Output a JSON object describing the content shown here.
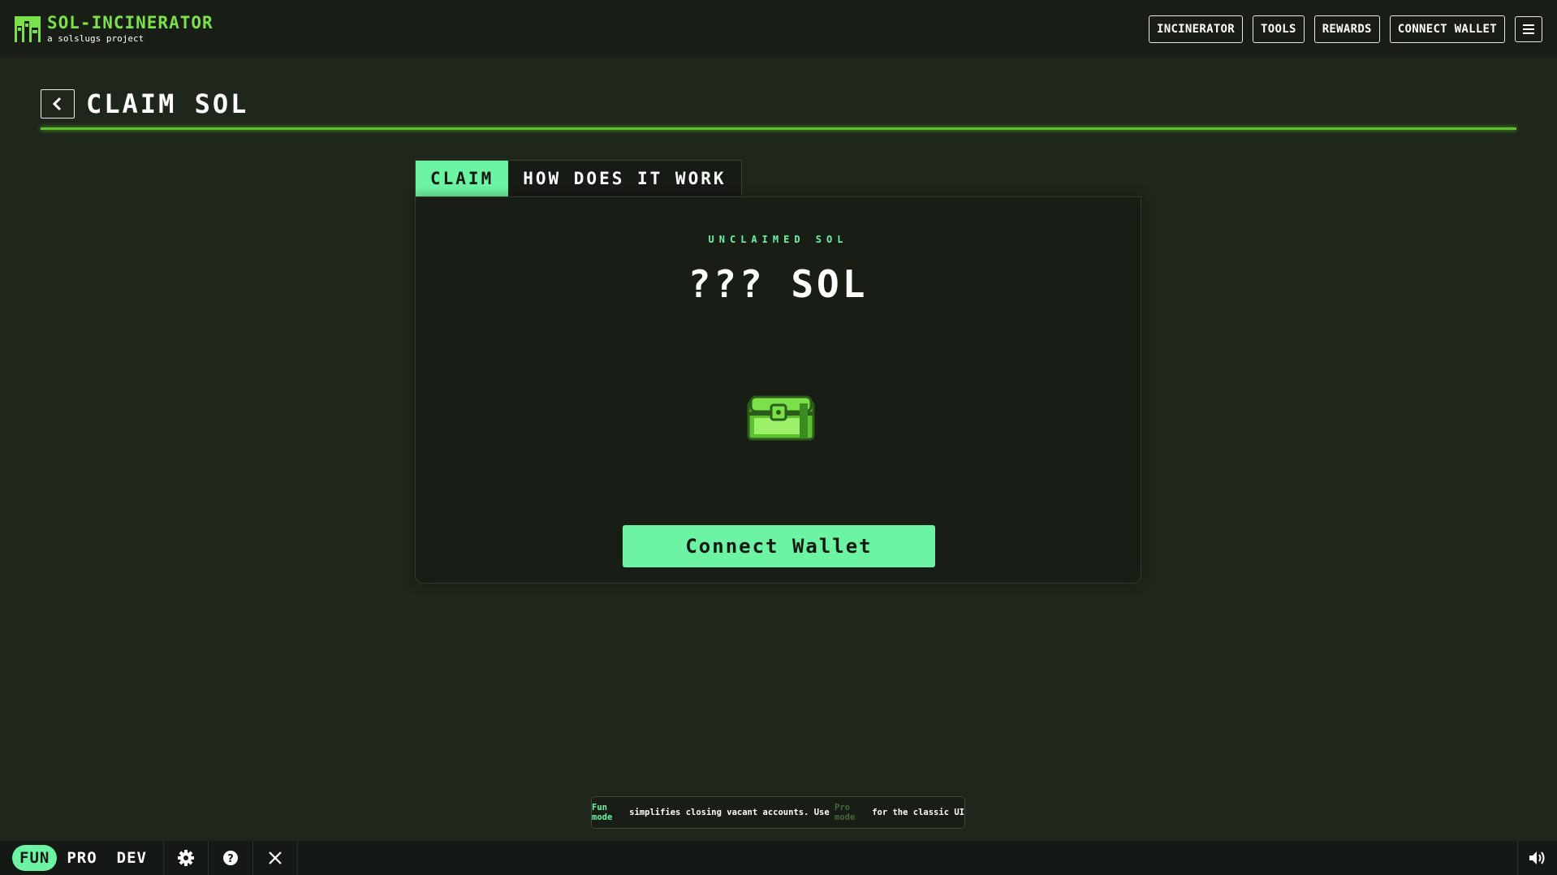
{
  "brand": {
    "title": "SOL-INCINERATOR",
    "subtitle": "a solslugs project",
    "accent": "#7be04a"
  },
  "nav": {
    "items": [
      "INCINERATOR",
      "TOOLS",
      "REWARDS",
      "CONNECT WALLET"
    ],
    "menu_icon": "hamburger-icon"
  },
  "page": {
    "title": "CLAIM SOL",
    "back_icon": "chevron-left-icon"
  },
  "tabs": [
    {
      "label": "CLAIM",
      "active": true
    },
    {
      "label": "HOW DOES IT WORK",
      "active": false
    }
  ],
  "card": {
    "label": "UNCLAIMED SOL",
    "amount": "??? SOL",
    "image_icon": "treasure-chest-icon",
    "button_label": "Connect Wallet",
    "button_color": "#6cf3a3"
  },
  "note": {
    "part1": "Fun mode",
    "part2": " simplifies closing vacant accounts. Use ",
    "part3": "Pro mode",
    "part4": " for the classic UI"
  },
  "footer": {
    "modes": [
      "FUN",
      "PRO",
      "DEV"
    ],
    "active_mode": "FUN",
    "icons": [
      "gear-icon",
      "help-icon",
      "x-logo-icon"
    ],
    "sound_icon": "speaker-icon"
  }
}
